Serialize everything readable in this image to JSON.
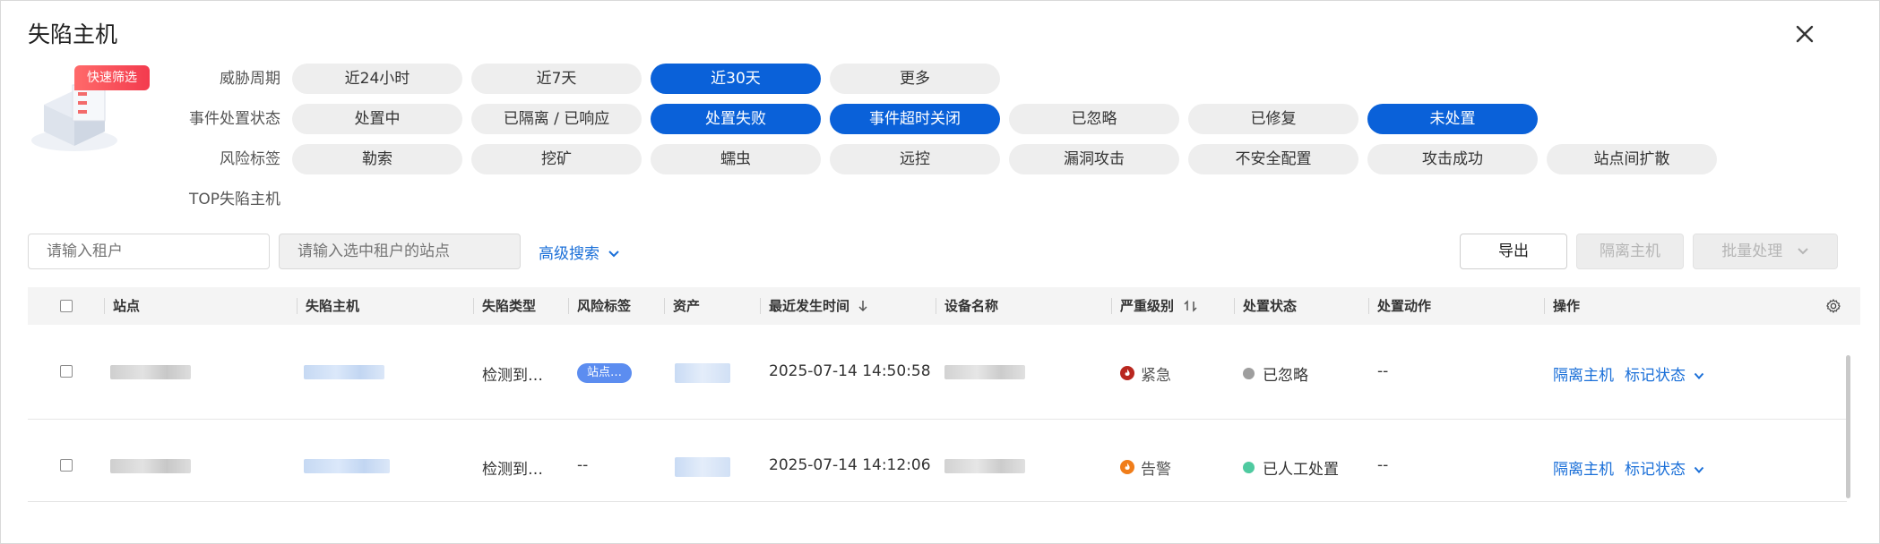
{
  "dialog": {
    "title": "失陷主机"
  },
  "quick_filter": {
    "badge": "快速筛选",
    "rows": [
      {
        "label": "威胁周期",
        "options": [
          {
            "label": "近24小时",
            "active": false
          },
          {
            "label": "近7天",
            "active": false
          },
          {
            "label": "近30天",
            "active": true
          },
          {
            "label": "更多",
            "active": false
          }
        ]
      },
      {
        "label": "事件处置状态",
        "options": [
          {
            "label": "处置中",
            "active": false
          },
          {
            "label": "已隔离 / 已响应",
            "active": false
          },
          {
            "label": "处置失败",
            "active": true
          },
          {
            "label": "事件超时关闭",
            "active": true
          },
          {
            "label": "已忽略",
            "active": false
          },
          {
            "label": "已修复",
            "active": false
          },
          {
            "label": "未处置",
            "active": true
          }
        ]
      },
      {
        "label": "风险标签",
        "options": [
          {
            "label": "勒索",
            "active": false
          },
          {
            "label": "挖矿",
            "active": false
          },
          {
            "label": "蠕虫",
            "active": false
          },
          {
            "label": "远控",
            "active": false
          },
          {
            "label": "漏洞攻击",
            "active": false
          },
          {
            "label": "不安全配置",
            "active": false
          },
          {
            "label": "攻击成功",
            "active": false
          },
          {
            "label": "站点间扩散",
            "active": false
          }
        ]
      },
      {
        "label": "TOP失陷主机",
        "options": []
      }
    ]
  },
  "search": {
    "tenant_placeholder": "请输入租户",
    "site_placeholder": "请输入选中租户的站点",
    "advanced": "高级搜索"
  },
  "actions": {
    "export": "导出",
    "isolate": "隔离主机",
    "batch": "批量处理"
  },
  "table": {
    "columns": [
      "站点",
      "失陷主机",
      "失陷类型",
      "风险标签",
      "资产",
      "最近发生时间",
      "设备名称",
      "严重级别",
      "处置状态",
      "处置动作",
      "操作"
    ],
    "rows": [
      {
        "type": "检测到…",
        "tag": "站点…",
        "time": "2025-07-14 14:50:58",
        "severity": "紧急",
        "severity_color": "#c0392b",
        "status": "已忽略",
        "status_color": "#9e9e9e",
        "action": "--",
        "op1": "隔离主机",
        "op2": "标记状态"
      },
      {
        "type": "检测到…",
        "tag": "--",
        "time": "2025-07-14 14:12:06",
        "severity": "告警",
        "severity_color": "#f07d1a",
        "status": "已人工处置",
        "status_color": "#4fcaa0",
        "action": "--",
        "op1": "隔离主机",
        "op2": "标记状态"
      }
    ]
  },
  "colors": {
    "accent": "#0a61d9",
    "link": "#1a6fd8"
  }
}
